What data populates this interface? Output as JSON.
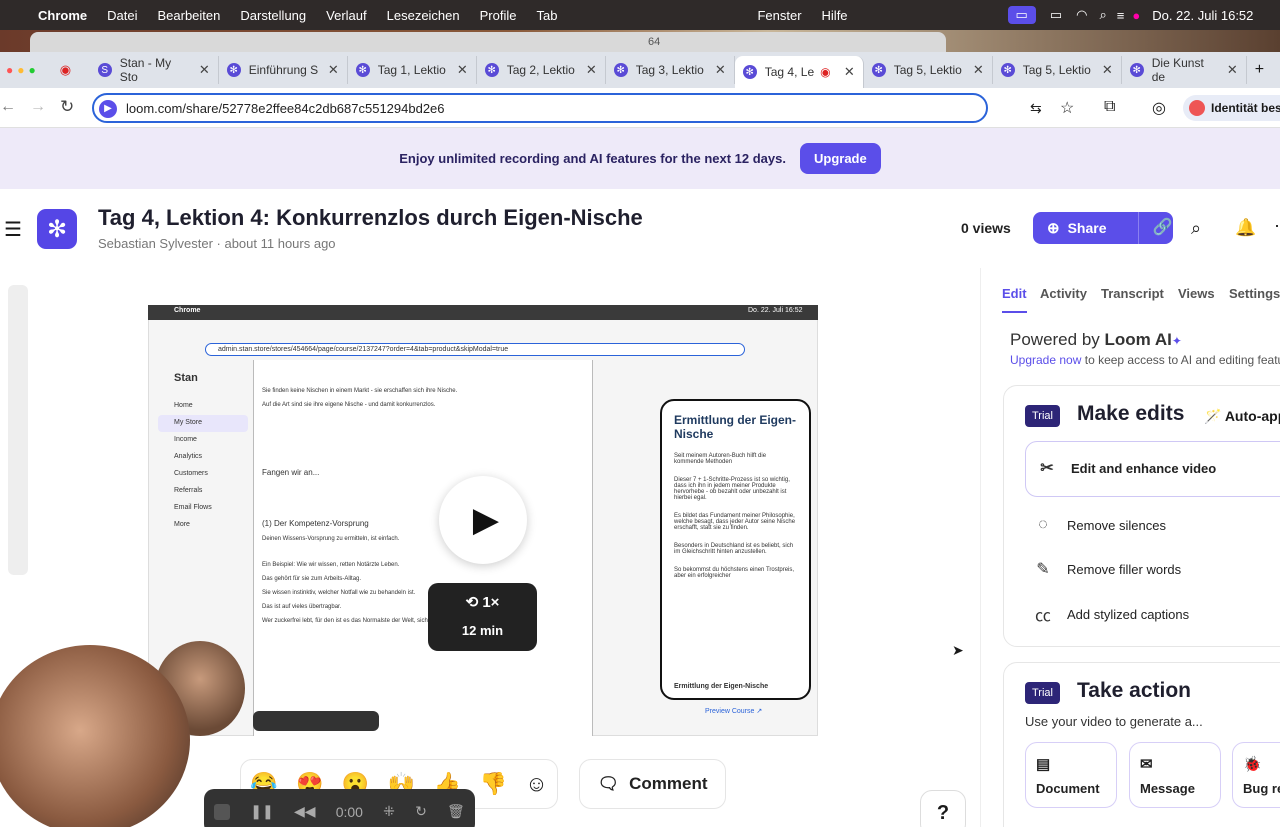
{
  "menubar": {
    "apple": "",
    "app": "Chrome",
    "items": [
      "Datei",
      "Bearbeiten",
      "Darstellung",
      "Verlauf",
      "Lesezeichen",
      "Profile",
      "Tab",
      "Fenster",
      "Hilfe"
    ],
    "clock": "Do. 22. Juli  16:52"
  },
  "ghost": {
    "text": "64"
  },
  "tabs": [
    {
      "label": "Stan - My Sto",
      "icon": "S"
    },
    {
      "label": "Einführung S",
      "icon": "✻"
    },
    {
      "label": "Tag 1, Lektio",
      "icon": "✻"
    },
    {
      "label": "Tag 2, Lektio",
      "icon": "✻"
    },
    {
      "label": "Tag 3, Lektio",
      "icon": "✻"
    },
    {
      "label": "Tag 4, Le",
      "icon": "✻"
    },
    {
      "label": "Tag 5, Lektio",
      "icon": "✻"
    },
    {
      "label": "Tag 5, Lektio",
      "icon": "✻"
    },
    {
      "label": "Die Kunst de",
      "icon": "✻"
    }
  ],
  "address": {
    "url": "loom.com/share/52778e2ffee84c2db687c551294bd2e6",
    "profile": "Identität bes"
  },
  "banner": {
    "text": "Enjoy unlimited recording and AI features for the next 12 days.",
    "button": "Upgrade"
  },
  "video": {
    "title": "Tag 4, Lektion 4: Konkurrenzlos durch Eigen-Nische",
    "author": "Sebastian Sylvester",
    "time": "about 11 hours ago",
    "views": "0 views",
    "share": "Share",
    "speed": "1×",
    "duration": "12 min",
    "inner": {
      "app": "Stan",
      "nav": [
        "Home",
        "My Store",
        "Income",
        "Analytics",
        "Customers",
        "Referrals",
        "Email Flows",
        "More"
      ],
      "url": "admin.stan.store/stores/454664/page/course/2137247?order=4&tab=product&skipModal=true",
      "doc": [
        "Sie finden keine Nischen in einem Markt - sie erschaffen sich ihre Nische.",
        "Auf die Art sind sie ihre eigene Nische - und damit konkurrenzlos.",
        "Fangen wir an...",
        "(1) Der Kompetenz-Vorsprung",
        "Deinen Wissens-Vorsprung zu ermitteln, ist einfach.",
        "Ein Beispiel: Wie wir wissen, retten Notärzte Leben.",
        "Das gehört für sie zum Arbeits-Alltag.",
        "Sie wissen instinktiv, welcher Notfall wie zu behandeln ist.",
        "Das ist auf vieles übertragbar.",
        "Wer zuckerfrei lebt, für den ist es das Normalste der Welt, sich so zu ernähren."
      ],
      "phone": {
        "title": "Ermittlung der Eigen-Nische",
        "body": [
          "Seit meinem Autoren-Buch hilft die kommende Methoden",
          "Dieser 7 + 1-Schritte-Prozess ist so wichtig, dass ich ihn in jedem meiner Produkte hervorhebe - ob bezahlt oder unbezahlt ist hierbei egal.",
          "Es bildet das Fundament meiner Philosophie, welche besagt, dass jeder Autor seine Nische erschafft, statt sie zu finden.",
          "Besonders in Deutschland ist es beliebt, sich im Gleichschritt hinten anzustellen.",
          "So bekommst du höchstens einen Trostpreis, aber ein erfolgreicher"
        ],
        "footer": "Ermittlung der Eigen-Nische",
        "link": "Preview Course ↗"
      }
    }
  },
  "reactions": [
    "😂",
    "😍",
    "😮",
    "🙌",
    "👍",
    "👎",
    "☺"
  ],
  "comment": "Comment",
  "recorder": {
    "time": "0:00"
  },
  "help": "?",
  "panel": {
    "tabs": [
      "Edit",
      "Activity",
      "Transcript",
      "Views",
      "Settings"
    ],
    "powered_by": "Powered by",
    "loom_ai": "Loom AI",
    "upgrade_link": "Upgrade now",
    "upgrade_rest": "to keep access to AI and editing featu",
    "card1": {
      "badge": "Trial",
      "title": "Make edits",
      "auto": "Auto-appl",
      "items": [
        "Edit and enhance video",
        "Remove silences",
        "Remove filler words",
        "Add stylized captions"
      ]
    },
    "card2": {
      "badge": "Trial",
      "title": "Take action",
      "desc": "Use your video to generate a...",
      "buttons": [
        "Document",
        "Message",
        "Bug re"
      ]
    }
  },
  "colors": {
    "accent": "#5b4ee9",
    "banner": "#eeeaf9",
    "trial": "#2d2577"
  }
}
